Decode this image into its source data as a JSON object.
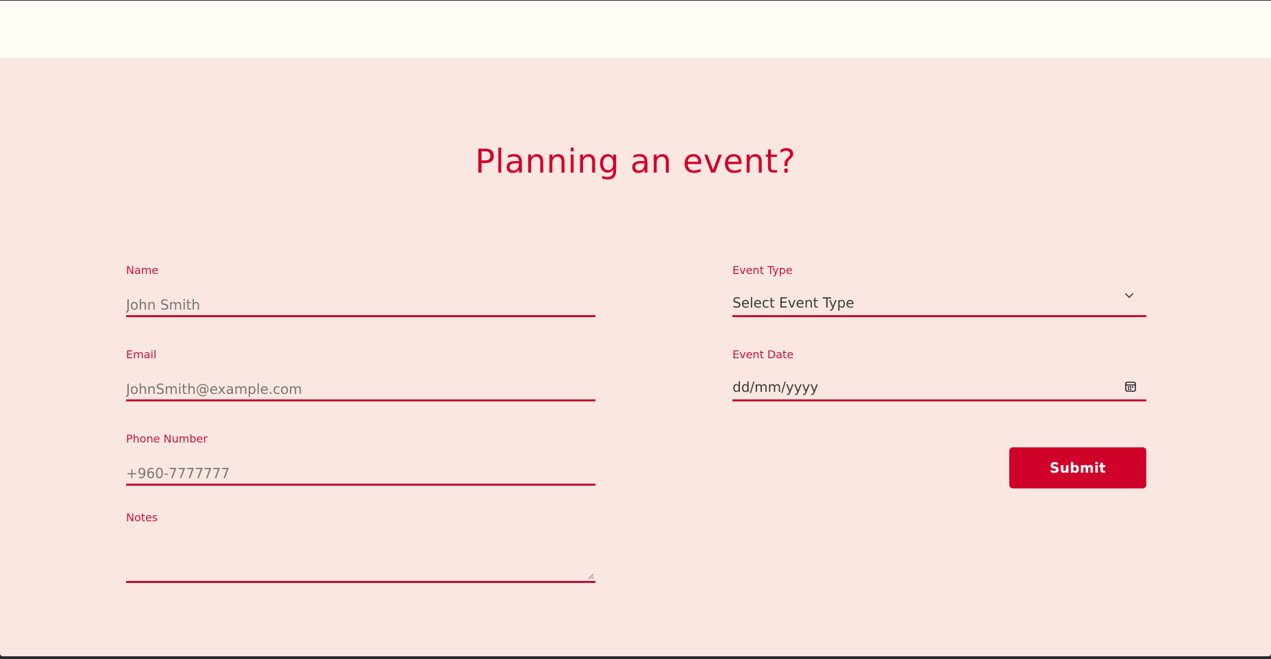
{
  "page": {
    "title": "Planning an event?"
  },
  "form": {
    "name": {
      "label": "Name",
      "placeholder": "John Smith"
    },
    "email": {
      "label": "Email",
      "placeholder": "JohnSmith@example.com"
    },
    "phone": {
      "label": "Phone Number",
      "placeholder": "+960-7777777"
    },
    "notes": {
      "label": "Notes",
      "value": ""
    },
    "event_type": {
      "label": "Event Type",
      "selected": "Select Event Type"
    },
    "event_date": {
      "label": "Event Date",
      "value": "dd/mm/yyyy"
    },
    "submit_label": "Submit"
  },
  "colors": {
    "accent": "#d0022a",
    "page_background": "#fae7e1",
    "header_background": "#fffdf6"
  },
  "icons": {
    "event_type_dropdown": "chevron-down-icon",
    "event_date_picker": "calendar-icon",
    "notes_resize": "resize-grip-icon"
  }
}
